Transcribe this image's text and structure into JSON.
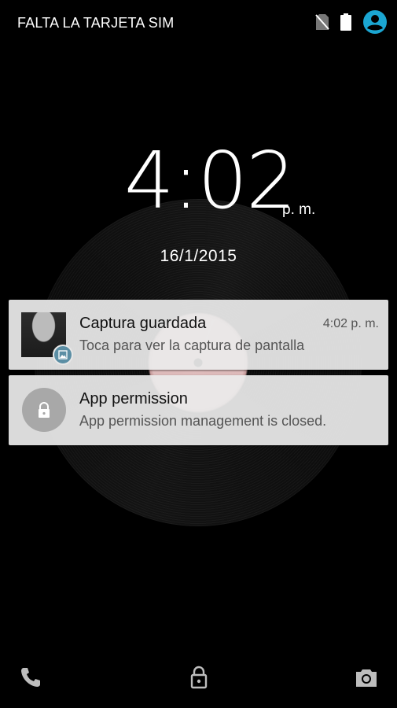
{
  "status_bar": {
    "carrier": "FALTA LA TARJETA SIM",
    "icons": [
      "no-sim-icon",
      "battery-icon",
      "user-icon"
    ],
    "accent_color": "#1ba6d2"
  },
  "clock": {
    "time": "4:02",
    "ampm": "p. m.",
    "date": "16/1/2015"
  },
  "notifications": [
    {
      "title": "Captura guardada",
      "text": "Toca para ver la captura de pantalla",
      "time": "4:02 p. m.",
      "icon": "screenshot-thumbnail",
      "badge_icon": "image-icon",
      "badge_color": "#5b8ea4"
    },
    {
      "title": "App permission",
      "text": "App permission management is closed.",
      "icon": "lock-icon"
    }
  ],
  "bottom_bar": {
    "icons": [
      "phone-icon",
      "unlock-icon",
      "camera-icon"
    ]
  }
}
